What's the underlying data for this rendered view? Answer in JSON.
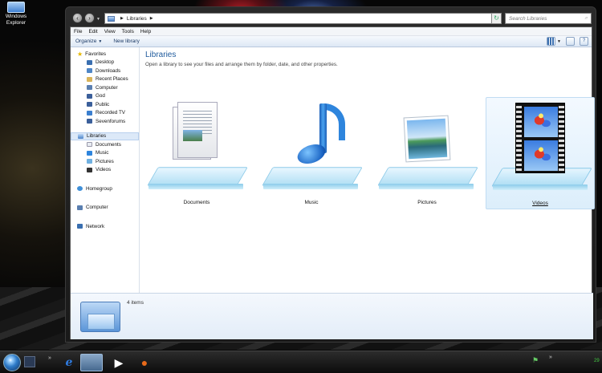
{
  "desktop": {
    "icon_label": "Windows Explorer"
  },
  "addressbar": {
    "path": "Libraries",
    "search_placeholder": "Search Libraries"
  },
  "menu": [
    "File",
    "Edit",
    "View",
    "Tools",
    "Help"
  ],
  "toolbar": {
    "organize": "Organize",
    "new_library": "New library",
    "help_icon": "?"
  },
  "nav": {
    "favorites": "Favorites",
    "favorite_items": [
      "Desktop",
      "Downloads",
      "Recent Places",
      "Computer",
      "God",
      "Public",
      "Recorded TV",
      "Sevenforums"
    ],
    "libraries": "Libraries",
    "library_items": [
      "Documents",
      "Music",
      "Pictures",
      "Videos"
    ],
    "homegroup": "Homegroup",
    "computer": "Computer",
    "network": "Network"
  },
  "main": {
    "title": "Libraries",
    "subtitle": "Open a library to see your files and arrange them by folder, date, and other properties.",
    "libraries": [
      {
        "name": "Documents",
        "icon": "documents-icon"
      },
      {
        "name": "Music",
        "icon": "music-icon"
      },
      {
        "name": "Pictures",
        "icon": "pictures-icon"
      },
      {
        "name": "Videos",
        "icon": "videos-icon"
      }
    ]
  },
  "details": {
    "count": "4 items"
  },
  "taskbar": {
    "quick_chevron": "»",
    "tray_chevron": "»",
    "clock": "29"
  },
  "colors": {
    "title_blue": "#1e5a9c",
    "selection": "#dce9f8",
    "window_frame": "#1a1a1a"
  }
}
